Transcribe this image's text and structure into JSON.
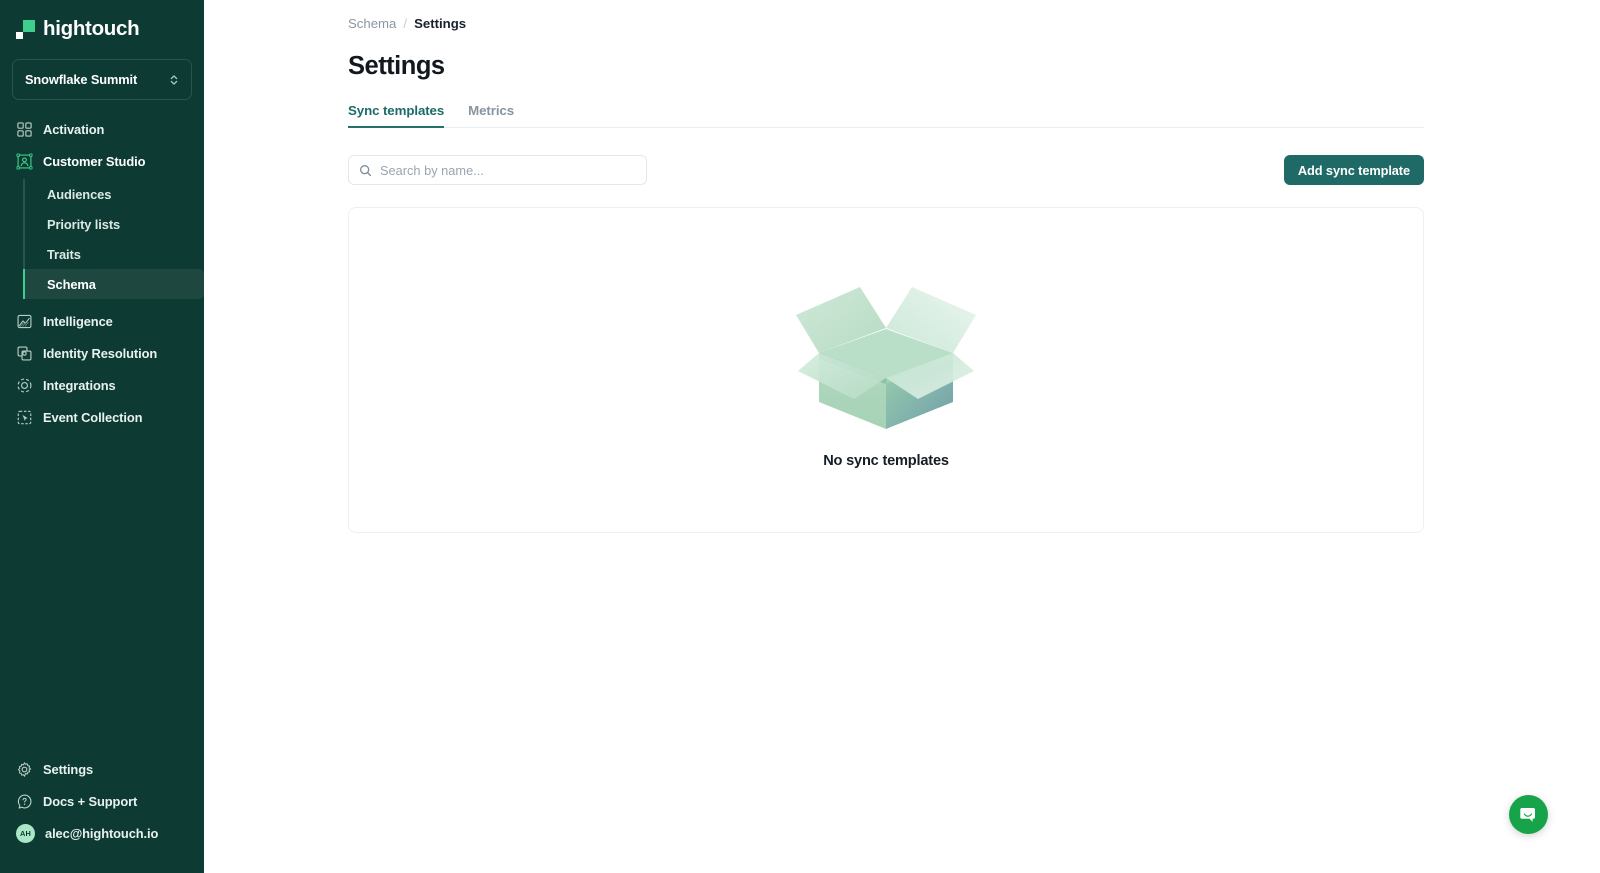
{
  "brand": {
    "name": "hightouch",
    "logo_icon": "hightouch-logo-mark",
    "accent_green": "#3ccf8e",
    "sidebar_bg": "#0d3a32"
  },
  "sidebar": {
    "workspace": {
      "name": "Snowflake Summit",
      "selector_icon": "chevron-up-down-icon"
    },
    "items": [
      {
        "label": "Activation",
        "icon": "grid-squares-icon",
        "active": false
      },
      {
        "label": "Customer Studio",
        "icon": "customer-studio-icon",
        "active": true
      },
      {
        "label": "Intelligence",
        "icon": "chart-area-icon",
        "active": false
      },
      {
        "label": "Identity Resolution",
        "icon": "overlapping-squares-icon",
        "active": false
      },
      {
        "label": "Integrations",
        "icon": "orbit-circle-icon",
        "active": false
      },
      {
        "label": "Event Collection",
        "icon": "cursor-square-icon",
        "active": false
      }
    ],
    "sub_items": [
      {
        "label": "Audiences",
        "active": false
      },
      {
        "label": "Priority lists",
        "active": false
      },
      {
        "label": "Traits",
        "active": false
      },
      {
        "label": "Schema",
        "active": true
      }
    ],
    "bottom_items": [
      {
        "label": "Settings",
        "icon": "gear-icon"
      },
      {
        "label": "Docs + Support",
        "icon": "question-circle-icon"
      }
    ],
    "user": {
      "email": "alec@hightouch.io",
      "initials": "AH",
      "avatar_bg": "#a9e7c8"
    }
  },
  "breadcrumb": {
    "parent": "Schema",
    "separator": "/",
    "current": "Settings"
  },
  "page": {
    "title": "Settings"
  },
  "tabs": [
    {
      "label": "Sync templates",
      "active": true
    },
    {
      "label": "Metrics",
      "active": false
    }
  ],
  "toolbar": {
    "search_placeholder": "Search by name...",
    "search_value": "",
    "search_icon": "search-icon",
    "add_button_label": "Add sync template",
    "add_button_color": "#1f6a66"
  },
  "empty_state": {
    "illustration": "open-box-illustration",
    "message": "No sync templates"
  },
  "support_widget": {
    "icon": "chat-bubble-icon",
    "color": "#16a34a"
  }
}
